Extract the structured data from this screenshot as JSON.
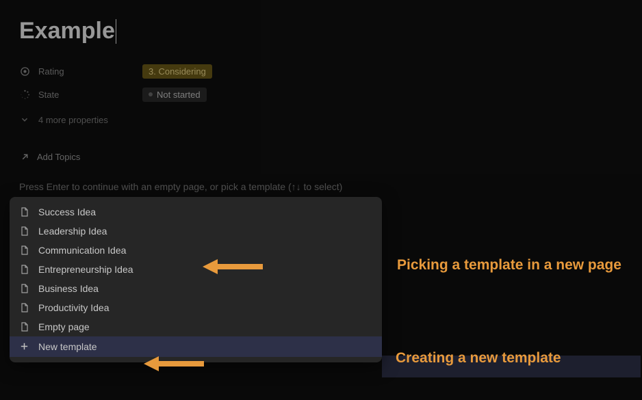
{
  "page": {
    "title": "Example"
  },
  "properties": {
    "rating": {
      "label": "Rating",
      "value": "3. Considering"
    },
    "state": {
      "label": "State",
      "value": "Not started"
    },
    "more": "4 more properties"
  },
  "addTopics": "Add Topics",
  "instruction": "Press Enter to continue with an empty page, or pick a template (↑↓ to select)",
  "templates": [
    "Success Idea",
    "Leadership Idea",
    "Communication Idea",
    "Entrepreneurship Idea",
    "Business Idea",
    "Productivity Idea",
    "Empty page"
  ],
  "newTemplate": "New template",
  "annotations": {
    "picking": "Picking a template in a new page",
    "creating": "Creating a new template"
  }
}
